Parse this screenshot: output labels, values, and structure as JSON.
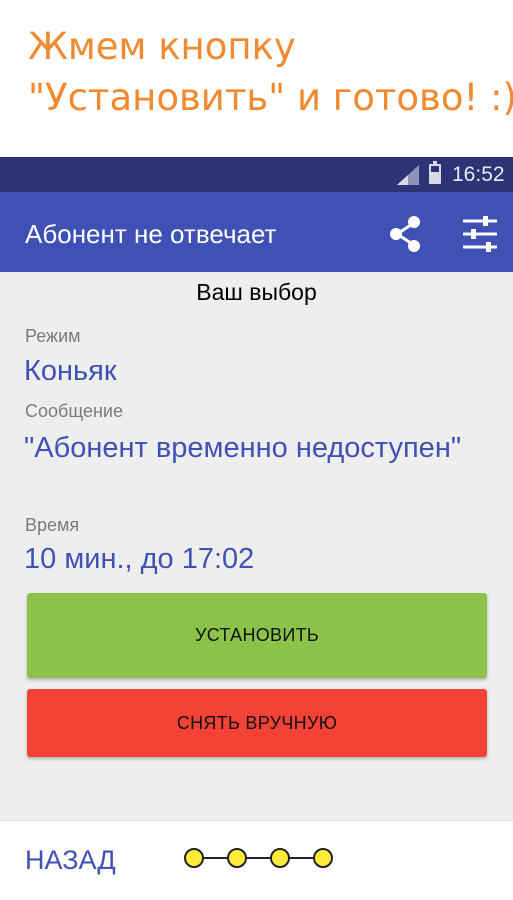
{
  "promo": {
    "line1": "Жмем кнопку",
    "line2": "\"Установить\" и готово! :))",
    "color": "#F0892F"
  },
  "status_bar": {
    "time": "16:52",
    "icons": [
      "signal-icon",
      "battery-icon"
    ]
  },
  "app_bar": {
    "title": "Абонент не отвечает",
    "actions": [
      "share-icon",
      "settings-sliders-icon"
    ],
    "color": "#3F51B5"
  },
  "main": {
    "heading": "Ваш выбор",
    "mode_label": "Режим",
    "mode_value": "Коньяк",
    "message_label": "Сообщение",
    "message_value": "\"Абонент временно недоступен\"",
    "time_label": "Время",
    "time_value": "10 мин., до 17:02"
  },
  "buttons": {
    "install": "УСТАНОВИТЬ",
    "remove": "СНЯТЬ ВРУЧНУЮ",
    "install_color": "#8BC34A",
    "remove_color": "#F44336"
  },
  "bottom": {
    "back": "НАЗАД",
    "progress_steps": 4,
    "progress_color": "#FFEB3B"
  }
}
